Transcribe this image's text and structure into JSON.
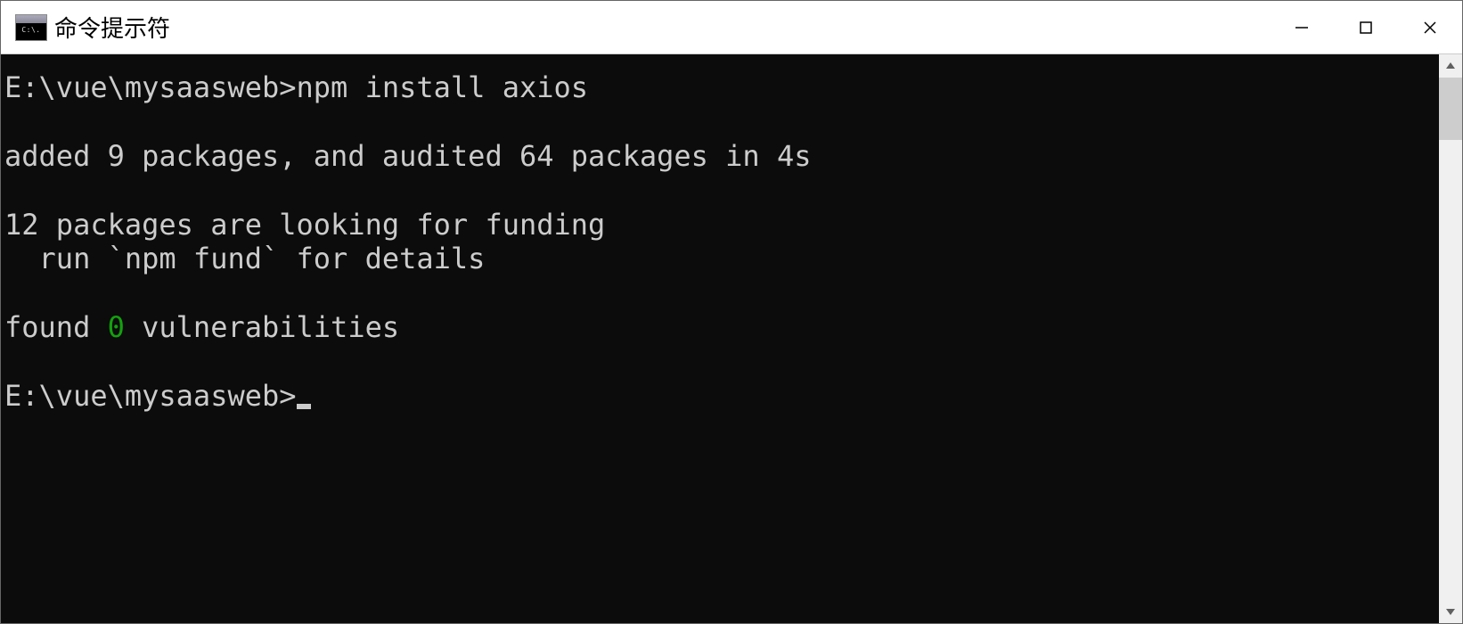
{
  "window": {
    "title": "命令提示符",
    "icon_label": "C:\\."
  },
  "terminal": {
    "line1_prompt": "E:\\vue\\mysaasweb>",
    "line1_cmd": "npm install axios",
    "line2_empty": "",
    "line3": "added 9 packages, and audited 64 packages in 4s",
    "line4_empty": "",
    "line5": "12 packages are looking for funding",
    "line6": "  run `npm fund` for details",
    "line7_empty": "",
    "line8_prefix": "found ",
    "line8_green": "0",
    "line8_suffix": " vulnerabilities",
    "line9_empty": "",
    "line10_prompt": "E:\\vue\\mysaasweb>"
  }
}
